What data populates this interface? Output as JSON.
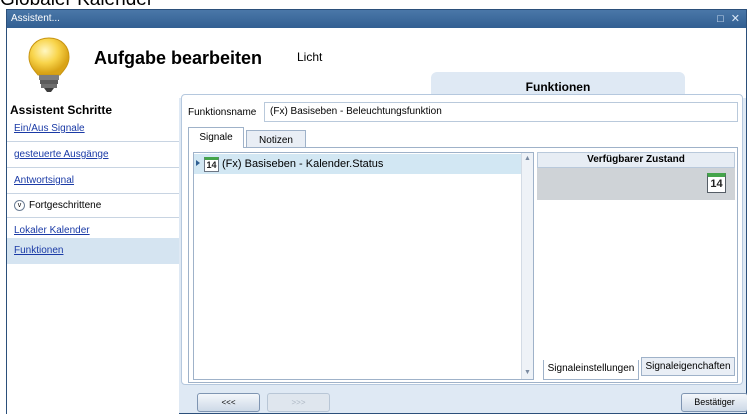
{
  "page": {
    "caption": "Globaler Kalender"
  },
  "window": {
    "title": "Assistent...",
    "controls": "□ ✕"
  },
  "header": {
    "title": "Aufgabe bearbeiten",
    "subtitle": "Licht",
    "tab_label": "Funktionen"
  },
  "sidebar": {
    "title": "Assistent Schritte",
    "items": [
      {
        "label": "Ein/Aus Signale",
        "type": "link"
      },
      {
        "label": "gesteuerte Ausgänge",
        "type": "link"
      },
      {
        "label": "Antwortsignal",
        "type": "link"
      },
      {
        "label": "Fortgeschrittene",
        "type": "group"
      },
      {
        "label": "Lokaler Kalender",
        "type": "link"
      },
      {
        "label": "Funktionen",
        "type": "link",
        "active": true
      }
    ]
  },
  "content": {
    "function_name_label": "Funktionsname",
    "function_name_value": "(Fx) Basiseben - Beleuchtungsfunktion",
    "tabs": [
      "Signale",
      "Notizen"
    ],
    "signal_rows": [
      {
        "icon_text": "14",
        "label": "(Fx) Basiseben - Kalender.Status"
      }
    ],
    "right_panel": {
      "header": "Verfügbarer Zustand",
      "state_icon_text": "14",
      "bottom_tabs": [
        "Signaleinstellungen",
        "Signaleigenchaften"
      ]
    }
  },
  "footer": {
    "back_label": "<<<",
    "forward_label": ">>>",
    "confirm_label": "Bestätiger"
  },
  "colors": {
    "titlebar": "#325f92",
    "panel": "#dfe9f4",
    "selection": "#d2e7f3",
    "link": "#1a3aa6"
  }
}
